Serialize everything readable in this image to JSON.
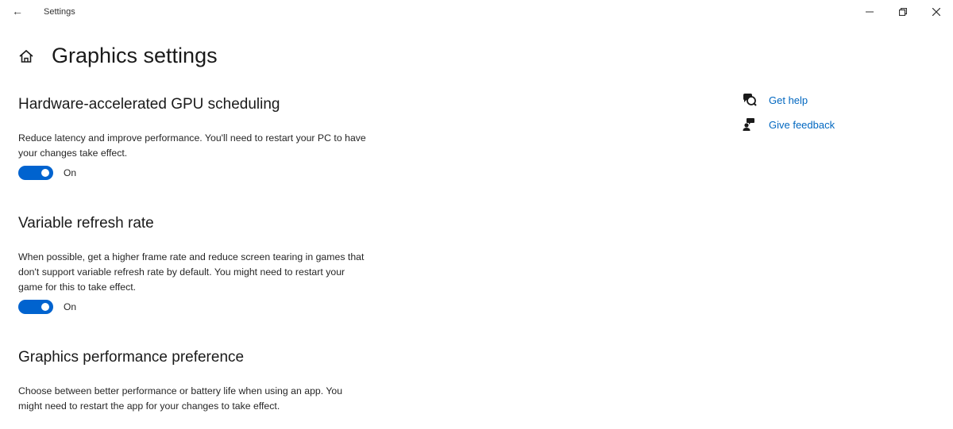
{
  "window": {
    "title": "Settings",
    "back_icon": "arrow-left-icon",
    "controls": {
      "minimize_icon": "minimize-icon",
      "maximize_icon": "restore-icon",
      "close_icon": "close-icon"
    }
  },
  "header": {
    "home_icon": "home-icon",
    "title": "Graphics settings"
  },
  "sections": [
    {
      "title": "Hardware-accelerated GPU scheduling",
      "description": "Reduce latency and improve performance. You'll need to restart your PC to have your changes take effect.",
      "toggle": {
        "state": "on",
        "label": "On"
      }
    },
    {
      "title": "Variable refresh rate",
      "description": "When possible, get a higher frame rate and reduce screen tearing in games that don't support variable refresh rate by default. You might need to restart your game for this to take effect.",
      "toggle": {
        "state": "on",
        "label": "On"
      }
    },
    {
      "title": "Graphics performance preference",
      "description": "Choose between better performance or battery life when using an app. You might need to restart the app for your changes to take effect."
    }
  ],
  "related": [
    {
      "icon": "get-help-icon",
      "label": "Get help"
    },
    {
      "icon": "give-feedback-icon",
      "label": "Give feedback"
    }
  ],
  "colors": {
    "accent": "#0063cf",
    "link": "#0067c0"
  }
}
